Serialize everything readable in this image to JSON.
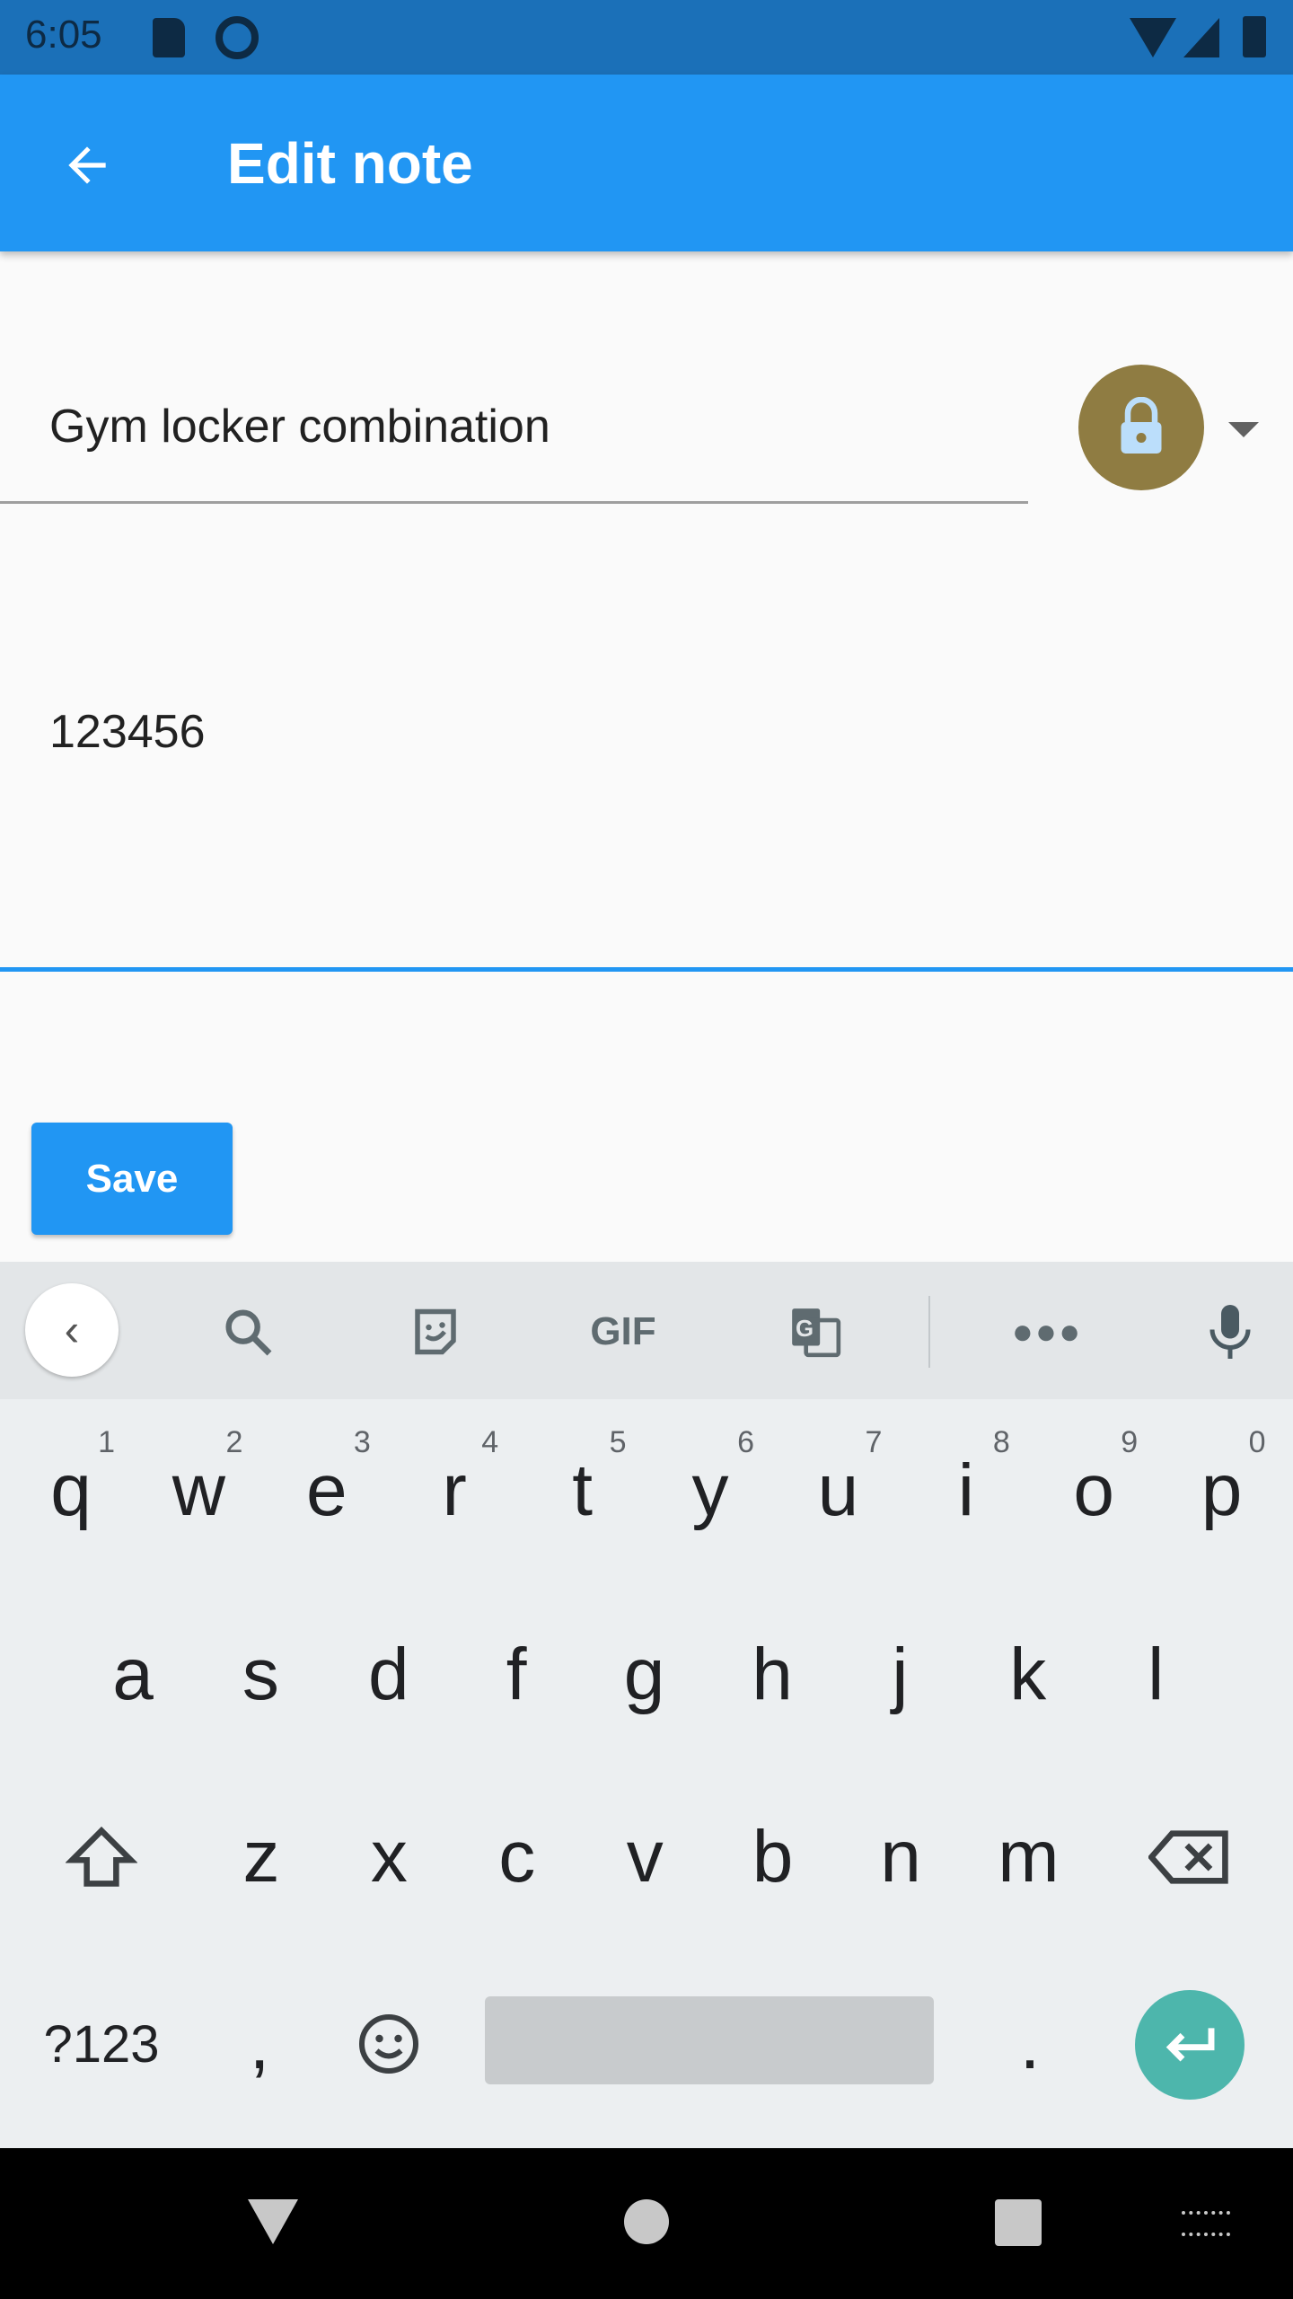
{
  "status_bar": {
    "time": "6:05",
    "icons": [
      "sd-card-icon",
      "vpn-q-icon",
      "wifi-icon",
      "signal-icon",
      "battery-icon"
    ]
  },
  "app_bar": {
    "title": "Edit note",
    "back_icon": "arrow-back-icon"
  },
  "form": {
    "title_value": "Gym locker combination",
    "body_value": "123456",
    "lock_color": "#8f7c42",
    "save_label": "Save"
  },
  "colors": {
    "primary": "#2196f3",
    "status": "#1b70b8",
    "enter_key": "#4db6ac"
  },
  "keyboard": {
    "toolbar": {
      "gif": "GIF"
    },
    "row1": [
      {
        "k": "q",
        "h": "1"
      },
      {
        "k": "w",
        "h": "2"
      },
      {
        "k": "e",
        "h": "3"
      },
      {
        "k": "r",
        "h": "4"
      },
      {
        "k": "t",
        "h": "5"
      },
      {
        "k": "y",
        "h": "6"
      },
      {
        "k": "u",
        "h": "7"
      },
      {
        "k": "i",
        "h": "8"
      },
      {
        "k": "o",
        "h": "9"
      },
      {
        "k": "p",
        "h": "0"
      }
    ],
    "row2": [
      "a",
      "s",
      "d",
      "f",
      "g",
      "h",
      "j",
      "k",
      "l"
    ],
    "row3": [
      "z",
      "x",
      "c",
      "v",
      "b",
      "n",
      "m"
    ],
    "symbols": "?123",
    "comma": ",",
    "period": "."
  }
}
